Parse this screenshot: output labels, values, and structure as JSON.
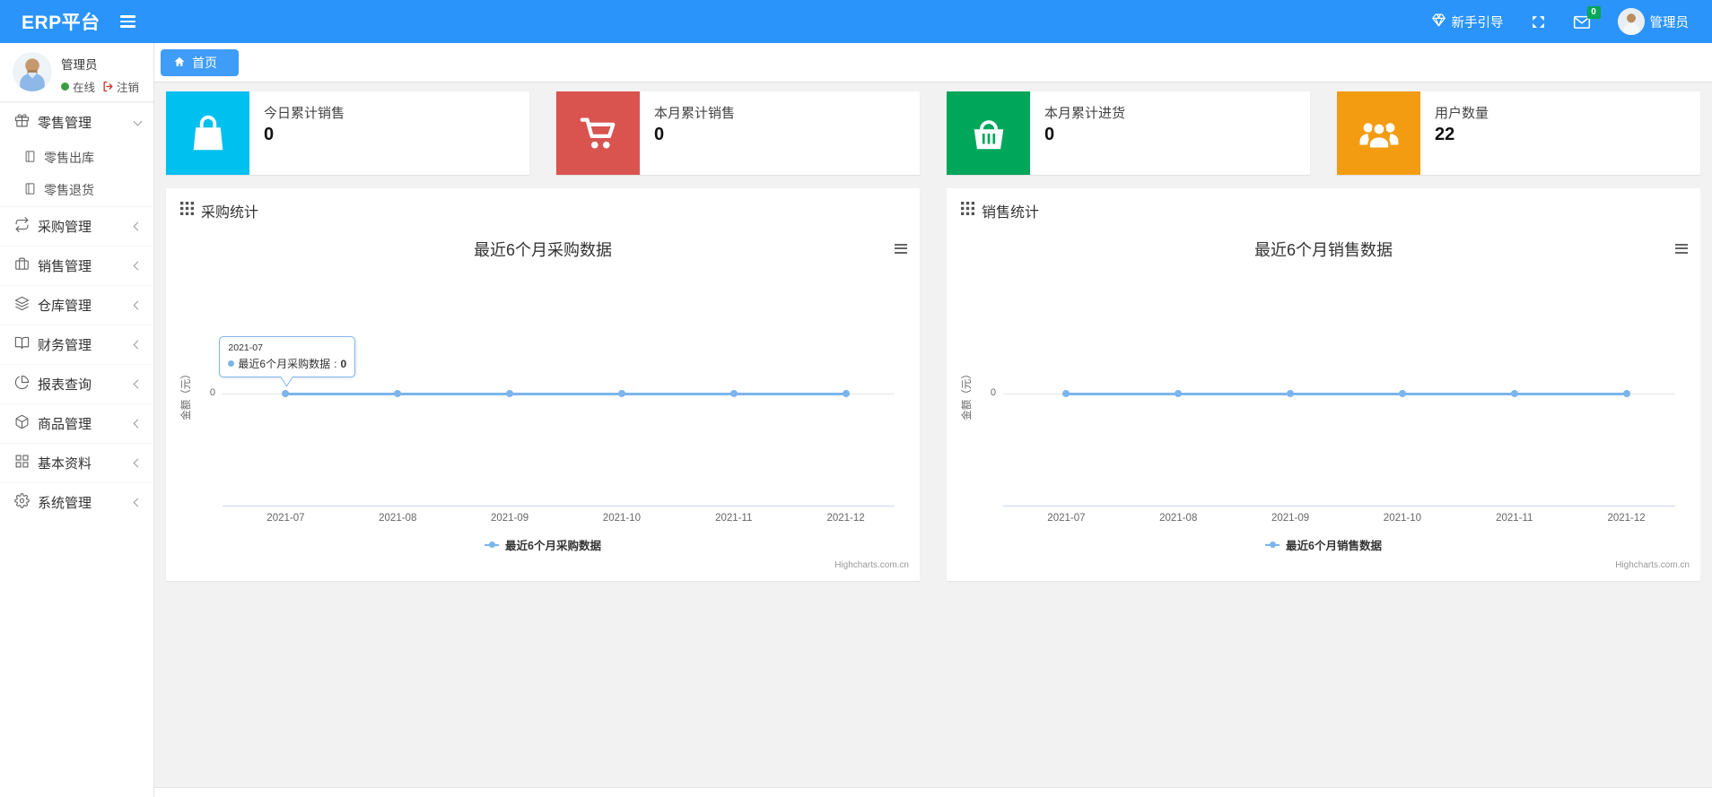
{
  "navbar": {
    "brand": "ERP平台",
    "guide_label": "新手引导",
    "message_count": "0",
    "user_name": "管理员"
  },
  "sidebar": {
    "user": {
      "name": "管理员",
      "status": "在线",
      "logout": "注销"
    },
    "menu": [
      {
        "label": "零售管理",
        "icon": "gift-icon",
        "expanded": true,
        "children": [
          "零售出库",
          "零售退货"
        ]
      },
      {
        "label": "采购管理",
        "icon": "repeat-icon"
      },
      {
        "label": "销售管理",
        "icon": "briefcase-icon"
      },
      {
        "label": "仓库管理",
        "icon": "layers-icon"
      },
      {
        "label": "财务管理",
        "icon": "book-icon"
      },
      {
        "label": "报表查询",
        "icon": "pie-icon"
      },
      {
        "label": "商品管理",
        "icon": "box-icon"
      },
      {
        "label": "基本资料",
        "icon": "grid-icon"
      },
      {
        "label": "系统管理",
        "icon": "gear-icon"
      }
    ]
  },
  "tabs": [
    {
      "label": "首页",
      "active": true
    }
  ],
  "stat_cards": [
    {
      "label": "今日累计销售",
      "value": "0",
      "color": "#00c0ef",
      "icon": "shopping-bag-icon"
    },
    {
      "label": "本月累计销售",
      "value": "0",
      "color": "#d9534f",
      "icon": "shopping-cart-icon"
    },
    {
      "label": "本月累计进货",
      "value": "0",
      "color": "#00a65a",
      "icon": "shopping-basket-icon"
    },
    {
      "label": "用户数量",
      "value": "22",
      "color": "#f39c12",
      "icon": "users-icon"
    }
  ],
  "chart_data": [
    {
      "type": "line",
      "panel_title": "采购统计",
      "title": "最近6个月采购数据",
      "x": [
        "2021-07",
        "2021-08",
        "2021-09",
        "2021-10",
        "2021-11",
        "2021-12"
      ],
      "series": [
        {
          "name": "最近6个月采购数据",
          "values": [
            0,
            0,
            0,
            0,
            0,
            0
          ]
        }
      ],
      "xlabel": "",
      "ylabel": "金额（元）",
      "y_tick": "0",
      "ylim": [
        0,
        0
      ],
      "grid": true,
      "legend_position": "bottom",
      "line_color": "#7cb5ec",
      "credits": "Highcharts.com.cn",
      "tooltip": {
        "header": "2021-07",
        "series": "最近6个月采购数据",
        "separator": ": ",
        "value": "0"
      }
    },
    {
      "type": "line",
      "panel_title": "销售统计",
      "title": "最近6个月销售数据",
      "x": [
        "2021-07",
        "2021-08",
        "2021-09",
        "2021-10",
        "2021-11",
        "2021-12"
      ],
      "series": [
        {
          "name": "最近6个月销售数据",
          "values": [
            0,
            0,
            0,
            0,
            0,
            0
          ]
        }
      ],
      "xlabel": "",
      "ylabel": "金额（元）",
      "y_tick": "0",
      "ylim": [
        0,
        0
      ],
      "grid": true,
      "legend_position": "bottom",
      "line_color": "#7cb5ec",
      "credits": "Highcharts.com.cn"
    }
  ]
}
